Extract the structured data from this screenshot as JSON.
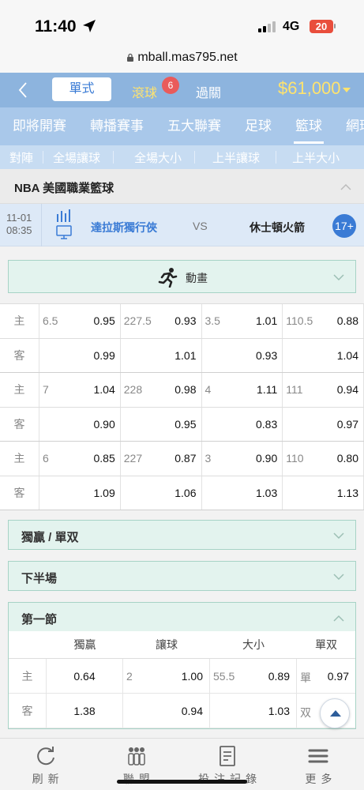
{
  "status": {
    "time": "11:40",
    "network": "4G",
    "battery": "20"
  },
  "browser": {
    "url": "mball.mas795.net"
  },
  "topnav": {
    "single_label": "單式",
    "live_label": "滾球",
    "live_count": "6",
    "parlay_label": "過關",
    "balance": "$61,000"
  },
  "sport_tabs": [
    "即將開賽",
    "轉播賽事",
    "五大聯賽",
    "足球",
    "籃球",
    "網球"
  ],
  "market_tabs": [
    "對陣",
    "全場讓球",
    "全場大小",
    "上半讓球",
    "上半大小"
  ],
  "league": {
    "name": "NBA 美國職業籃球"
  },
  "match": {
    "date": "11-01",
    "time": "08:35",
    "home": "達拉斯獨行俠",
    "vs": "VS",
    "away": "休士頓火箭",
    "more_count": "17+"
  },
  "animation": {
    "label": "動畫"
  },
  "odds_rows": [
    {
      "side": "主",
      "cells": [
        {
          "hc": "6.5",
          "od": "0.95"
        },
        {
          "hc": "227.5",
          "od": "0.93"
        },
        {
          "hc": "3.5",
          "od": "1.01"
        },
        {
          "hc": "110.5",
          "od": "0.88"
        }
      ]
    },
    {
      "side": "客",
      "cells": [
        {
          "hc": "",
          "od": "0.99"
        },
        {
          "hc": "",
          "od": "1.01"
        },
        {
          "hc": "",
          "od": "0.93"
        },
        {
          "hc": "",
          "od": "1.04"
        }
      ]
    },
    {
      "side": "主",
      "cells": [
        {
          "hc": "7",
          "od": "1.04"
        },
        {
          "hc": "228",
          "od": "0.98"
        },
        {
          "hc": "4",
          "od": "1.11"
        },
        {
          "hc": "111",
          "od": "0.94"
        }
      ]
    },
    {
      "side": "客",
      "cells": [
        {
          "hc": "",
          "od": "0.90"
        },
        {
          "hc": "",
          "od": "0.95"
        },
        {
          "hc": "",
          "od": "0.83"
        },
        {
          "hc": "",
          "od": "0.97"
        }
      ]
    },
    {
      "side": "主",
      "cells": [
        {
          "hc": "6",
          "od": "0.85"
        },
        {
          "hc": "227",
          "od": "0.87"
        },
        {
          "hc": "3",
          "od": "0.90"
        },
        {
          "hc": "110",
          "od": "0.80"
        }
      ]
    },
    {
      "side": "客",
      "cells": [
        {
          "hc": "",
          "od": "1.09"
        },
        {
          "hc": "",
          "od": "1.06"
        },
        {
          "hc": "",
          "od": "1.03"
        },
        {
          "hc": "",
          "od": "1.13"
        }
      ]
    }
  ],
  "sections": {
    "moneyline_oddeven": "獨贏 / 單双",
    "second_half": "下半場",
    "first_quarter": "第一節"
  },
  "quarter_table": {
    "headers": [
      "獨贏",
      "讓球",
      "大小",
      "單双"
    ],
    "rows": [
      {
        "side": "主",
        "ml": "0.64",
        "hc": "2",
        "hc_od": "1.00",
        "ou": "55.5",
        "ou_od": "0.89",
        "oe": "單",
        "oe_od": "0.97"
      },
      {
        "side": "客",
        "ml": "1.38",
        "hc": "",
        "hc_od": "0.94",
        "ou": "",
        "ou_od": "1.03",
        "oe": "双",
        "oe_od": ""
      }
    ]
  },
  "bottom_nav": [
    "刷新",
    "聯盟",
    "投注記錄",
    "更多"
  ],
  "colors": {
    "nav_blue": "#8db4de",
    "accent_yellow": "#ffe36e",
    "link_blue": "#3a7bd5",
    "section_green": "#e3f3ee"
  }
}
